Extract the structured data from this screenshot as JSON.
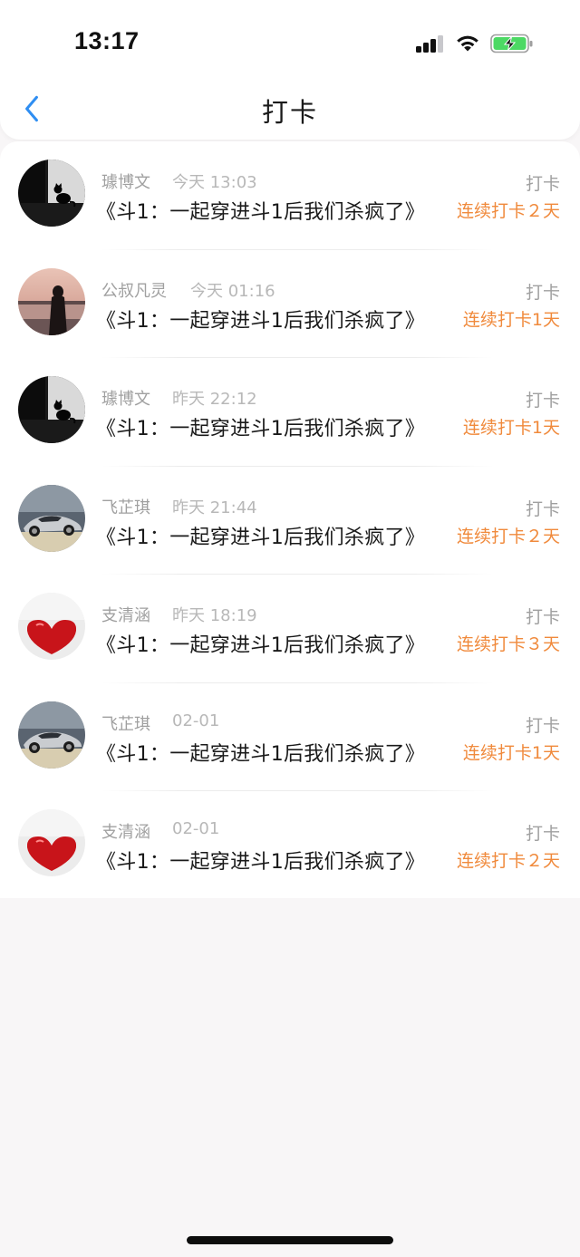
{
  "status_bar": {
    "time": "13:17"
  },
  "nav": {
    "back_icon": "chevron-left-icon",
    "title": "打卡",
    "accent_color": "#2f8ef2"
  },
  "checkins": [
    {
      "name": "璩博文",
      "time": "今天 13:03",
      "book": "《斗1：一起穿进斗1后我们杀疯了》",
      "kind": "打卡",
      "streak": "连续打卡２天",
      "avatar": "cat-silhouette"
    },
    {
      "name": "公叔凡灵",
      "time": "今天 01:16",
      "book": "《斗1：一起穿进斗1后我们杀疯了》",
      "kind": "打卡",
      "streak": "连续打卡1天",
      "avatar": "girl-sunset"
    },
    {
      "name": "璩博文",
      "time": "昨天 22:12",
      "book": "《斗1：一起穿进斗1后我们杀疯了》",
      "kind": "打卡",
      "streak": "连续打卡1天",
      "avatar": "cat-silhouette"
    },
    {
      "name": "飞芷琪",
      "time": "昨天 21:44",
      "book": "《斗1：一起穿进斗1后我们杀疯了》",
      "kind": "打卡",
      "streak": "连续打卡２天",
      "avatar": "sports-car"
    },
    {
      "name": "支清涵",
      "time": "昨天 18:19",
      "book": "《斗1：一起穿进斗1后我们杀疯了》",
      "kind": "打卡",
      "streak": "连续打卡３天",
      "avatar": "red-heart"
    },
    {
      "name": "飞芷琪",
      "time": "02-01",
      "book": "《斗1：一起穿进斗1后我们杀疯了》",
      "kind": "打卡",
      "streak": "连续打卡1天",
      "avatar": "sports-car"
    },
    {
      "name": "支清涵",
      "time": "02-01",
      "book": "《斗1：一起穿进斗1后我们杀疯了》",
      "kind": "打卡",
      "streak": "连续打卡２天",
      "avatar": "red-heart"
    }
  ],
  "colors": {
    "streak": "#f08a3c",
    "muted": "#a0a0a0",
    "background": "#f8f6f7"
  }
}
